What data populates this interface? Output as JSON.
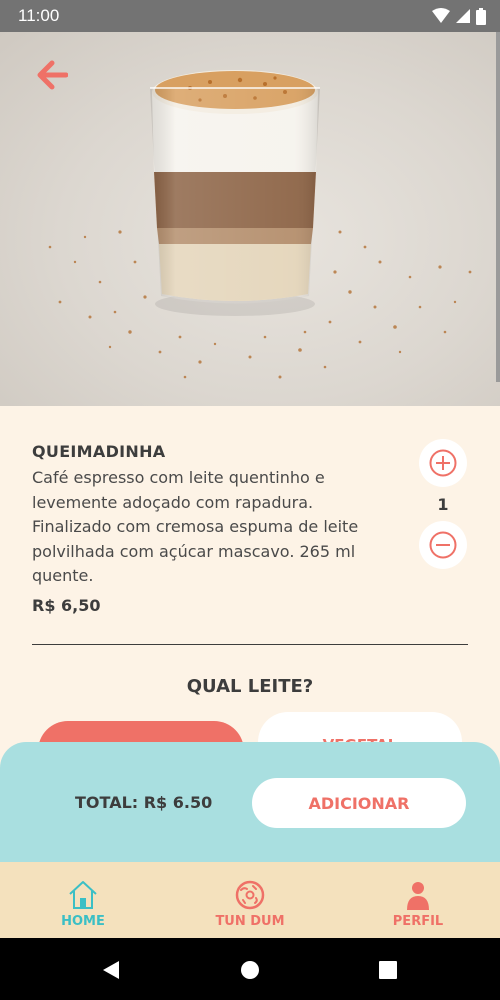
{
  "status_bar": {
    "time": "11:00"
  },
  "product": {
    "name": "QUEIMADINHA",
    "description": "Café espresso com leite quentinho e levemente adoçado com rapadura. Finalizado com cremosa espuma de leite polvilhada com açúcar mascavo. 265 ml quente.",
    "price": "R$ 6,50",
    "quantity": "1"
  },
  "milk_section": {
    "title": "QUAL LEITE?",
    "options": [
      "",
      "VEGETAL"
    ]
  },
  "cart": {
    "total": "TOTAL: R$ 6.50",
    "add_label": "ADICIONAR"
  },
  "nav": {
    "items": [
      {
        "label": "HOME",
        "icon": "house-icon"
      },
      {
        "label": "TUN DUM",
        "icon": "donut-icon"
      },
      {
        "label": "PERFIL",
        "icon": "person-icon"
      }
    ]
  },
  "colors": {
    "accent": "#ef7167",
    "teal": "#3bbfc5",
    "panel": "#a9dfe0",
    "nav_bg": "#f4e1bd",
    "background": "#fdf3e6"
  }
}
